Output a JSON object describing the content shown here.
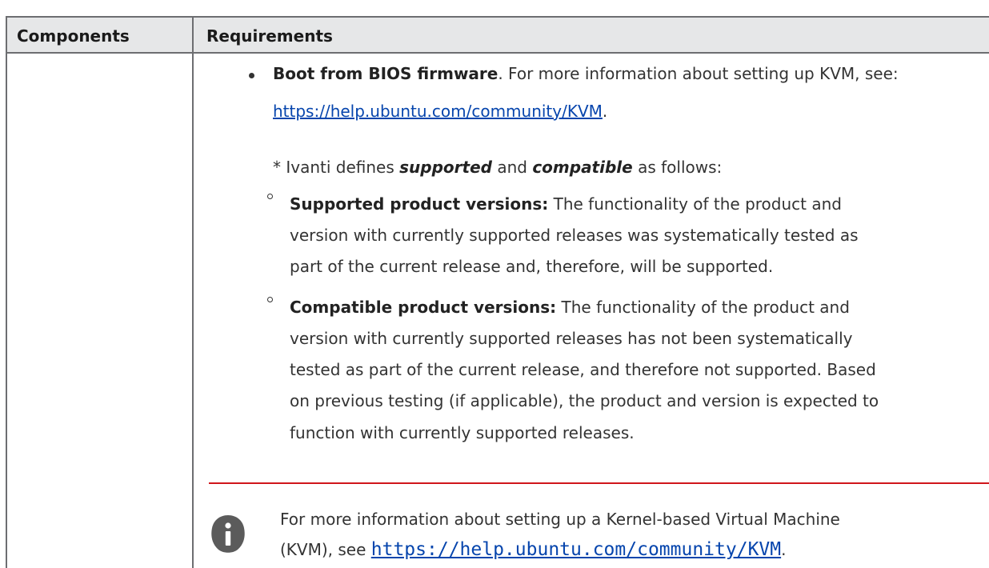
{
  "table": {
    "headers": [
      "Components",
      "Requirements"
    ]
  },
  "bullet": {
    "title": "Boot from BIOS firmware",
    "text": ". For more information about setting up KVM, see:",
    "link": "https://help.ubuntu.com/community/KVM",
    "link_suffix": "."
  },
  "definition": {
    "intro_prefix": "* Ivanti defines ",
    "supported_word": "supported",
    "and_word": " and ",
    "compatible_word": "compatible",
    "intro_suffix": " as follows:",
    "items": [
      {
        "label": "Supported product versions:",
        "lines": [
          " The functionality of the product and",
          "version with currently supported releases was systematically tested as",
          "part of the current release and, therefore, will be supported."
        ]
      },
      {
        "label": "Compatible product versions:",
        "lines": [
          " The functionality of the product and",
          "version with currently supported releases has not been systematically",
          "tested as part of the current release, and therefore not supported. Based",
          "on previous testing (if applicable), the product and version is expected to",
          "function with currently supported releases."
        ]
      }
    ]
  },
  "note": {
    "line1": "For more information about setting up a Kernel-based Virtual Machine",
    "line2_prefix": "(KVM), see ",
    "link": "https://help.ubuntu.com/community/KVM",
    "link_suffix": ".",
    "icon": "info-icon"
  },
  "colors": {
    "header_bg": "#e6e7e8",
    "border": "#6d6e71",
    "link": "#0645ad",
    "note_rule": "#d0161b",
    "icon": "#5b5b5b"
  }
}
